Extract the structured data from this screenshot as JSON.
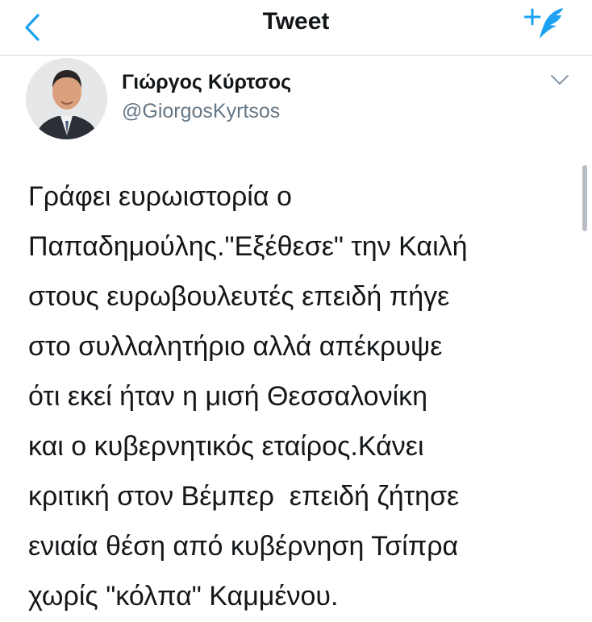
{
  "nav": {
    "title": "Tweet",
    "back_icon": "chevron-left-icon",
    "compose_icon": "compose-tweet-icon"
  },
  "colors": {
    "accent": "#1da1f2",
    "text": "#14171a",
    "secondary": "#657786"
  },
  "author": {
    "name": "Γιώργος Κύρτσος",
    "handle": "@GiorgosKyrtsos"
  },
  "tweet": {
    "lines": [
      "Γράφει ευρωιστορία ο",
      "Παπαδημούλης.\"Εξέθεσε\" την Καιλή",
      "στους ευρωβουλευτές επειδή πήγε",
      "στο συλλαλητήριο αλλά απέκρυψε",
      "ότι εκεί ήταν η μισή Θεσσαλονίκη",
      "και ο κυβερνητικός εταίρος.Κάνει",
      "κριτική στον Βέμπερ  επειδή ζήτησε",
      "ενιαία θέση από κυβέρνηση Τσίπρα",
      "χωρίς \"κόλπα\" Καμμένου."
    ]
  }
}
